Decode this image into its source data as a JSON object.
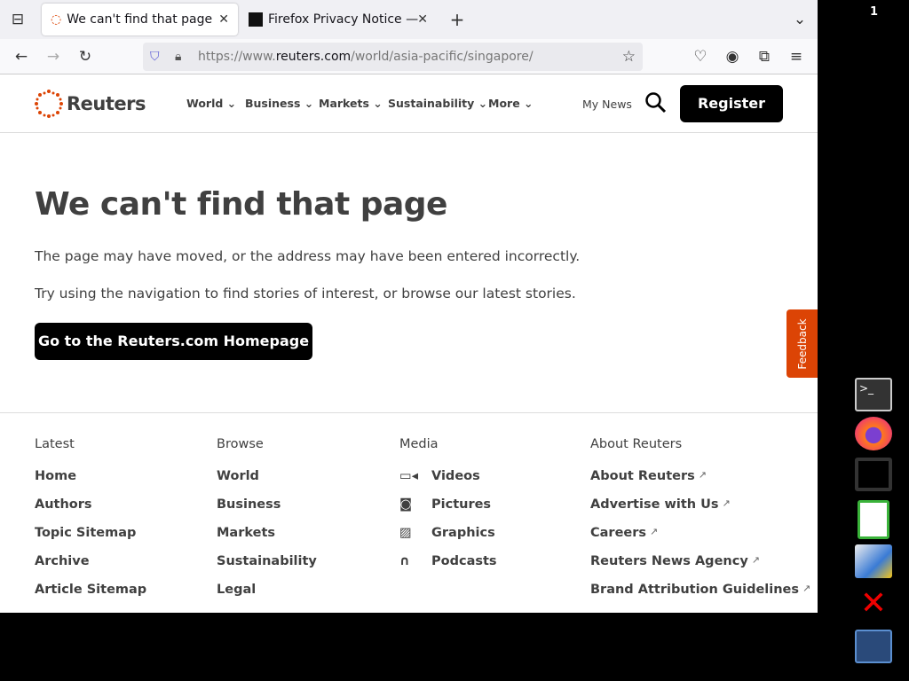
{
  "browser": {
    "tabs": [
      {
        "title": "We can't find that page",
        "active": true
      },
      {
        "title": "Firefox Privacy Notice —",
        "active": false
      }
    ],
    "url_prefix": "https://www.",
    "url_domain": "reuters.com",
    "url_path": "/world/asia-pacific/singapore/"
  },
  "header": {
    "logo": "Reuters",
    "nav": [
      "World",
      "Business",
      "Markets",
      "Sustainability",
      "More"
    ],
    "my_news": "My News",
    "register": "Register"
  },
  "main": {
    "title": "We can't find that page",
    "line1": "The page may have moved, or the address may have been entered incorrectly.",
    "line2": "Try using the navigation to find stories of interest, or browse our latest stories.",
    "button": "Go to the Reuters.com Homepage",
    "feedback": "Feedback"
  },
  "footer": {
    "columns": [
      {
        "heading": "Latest",
        "links": [
          "Home",
          "Authors",
          "Topic Sitemap",
          "Archive",
          "Article Sitemap"
        ]
      },
      {
        "heading": "Browse",
        "links": [
          "World",
          "Business",
          "Markets",
          "Sustainability",
          "Legal"
        ]
      },
      {
        "heading": "Media",
        "links": [
          "Videos",
          "Pictures",
          "Graphics",
          "Podcasts"
        ],
        "icons": [
          "video-icon",
          "camera-icon",
          "image-icon",
          "headphones-icon"
        ]
      },
      {
        "heading": "About Reuters",
        "links": [
          "About Reuters",
          "Advertise with Us",
          "Careers",
          "Reuters News Agency",
          "Brand Attribution Guidelines"
        ],
        "external": true
      }
    ]
  },
  "desktop": {
    "workspace": "1",
    "dock": [
      "terminal",
      "firefox",
      "text-editor",
      "spreadsheet",
      "image-viewer",
      "pdf-viewer",
      "calculator"
    ]
  },
  "colors": {
    "accent": "#dc4405",
    "button": "#000000"
  }
}
